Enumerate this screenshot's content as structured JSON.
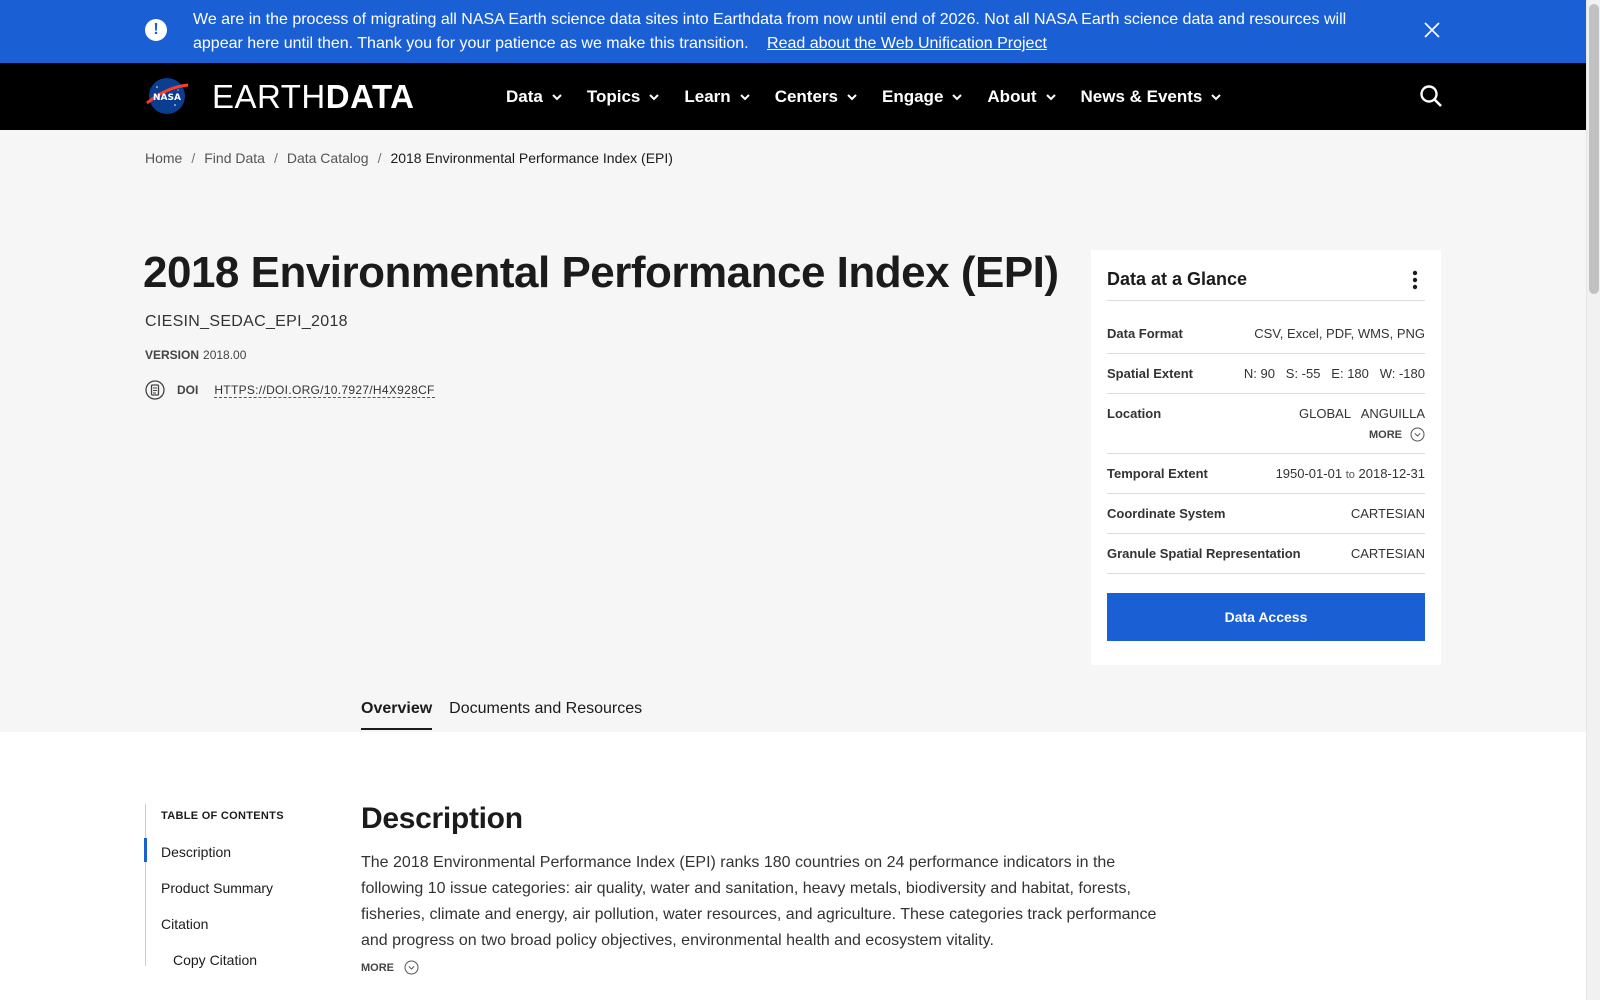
{
  "banner": {
    "message": "We are in the process of migrating all NASA Earth science data sites into Earthdata from now until end of 2026. Not all NASA Earth science data and resources will appear here until then. Thank you for your patience as we make this transition.",
    "link_label": "Read about the Web Unification Project",
    "icon": "alert-icon",
    "bg_color": "#1a5fd4"
  },
  "header": {
    "logo_text": "NASA",
    "brand_light": "EARTH",
    "brand_bold": "DATA",
    "nav": [
      {
        "label": "Data"
      },
      {
        "label": "Topics"
      },
      {
        "label": "Learn"
      },
      {
        "label": "Centers"
      },
      {
        "label": "Engage"
      },
      {
        "label": "About"
      },
      {
        "label": "News & Events"
      }
    ]
  },
  "breadcrumb": {
    "items": [
      "Home",
      "Find Data",
      "Data Catalog"
    ],
    "separator": "/",
    "current": "2018 Environmental Performance Index (EPI)"
  },
  "dataset": {
    "title": "2018 Environmental Performance Index (EPI)",
    "short_name": "CIESIN_SEDAC_EPI_2018",
    "version_label": "VERSION",
    "version": "2018.00",
    "doi_label": "DOI",
    "doi_link": "HTTPS://DOI.ORG/10.7927/H4X928CF"
  },
  "glance": {
    "title": "Data at a Glance",
    "rows": {
      "format": {
        "key": "Data Format",
        "value": "CSV, Excel, PDF, WMS, PNG"
      },
      "spatial": {
        "key": "Spatial Extent",
        "value": "N: 90   S: -55   E: 180   W: -180"
      },
      "location": {
        "key": "Location",
        "value": "GLOBAL   ANGUILLA",
        "more": "MORE"
      },
      "temporal": {
        "key": "Temporal Extent",
        "start": "1950-01-01",
        "to": "to",
        "end": "2018-12-31"
      },
      "coord": {
        "key": "Coordinate System",
        "value": "CARTESIAN"
      },
      "granule": {
        "key": "Granule Spatial Representation",
        "value": "CARTESIAN"
      }
    },
    "button": "Data Access"
  },
  "tabs": [
    "Overview",
    "Documents and Resources"
  ],
  "toc": {
    "title": "TABLE OF CONTENTS",
    "items": [
      "Description",
      "Product Summary",
      "Citation",
      "Copy Citation"
    ]
  },
  "description": {
    "heading": "Description",
    "text": "The 2018 Environmental Performance Index (EPI) ranks 180 countries on 24 performance indicators in the following 10 issue categories: air quality, water and sanitation, heavy metals, biodiversity and habitat, forests, fisheries, climate and energy, air pollution, water resources, and agriculture. These categories track performance and progress on two broad policy objectives, environmental health and ecosystem vitality.",
    "more": "MORE"
  }
}
